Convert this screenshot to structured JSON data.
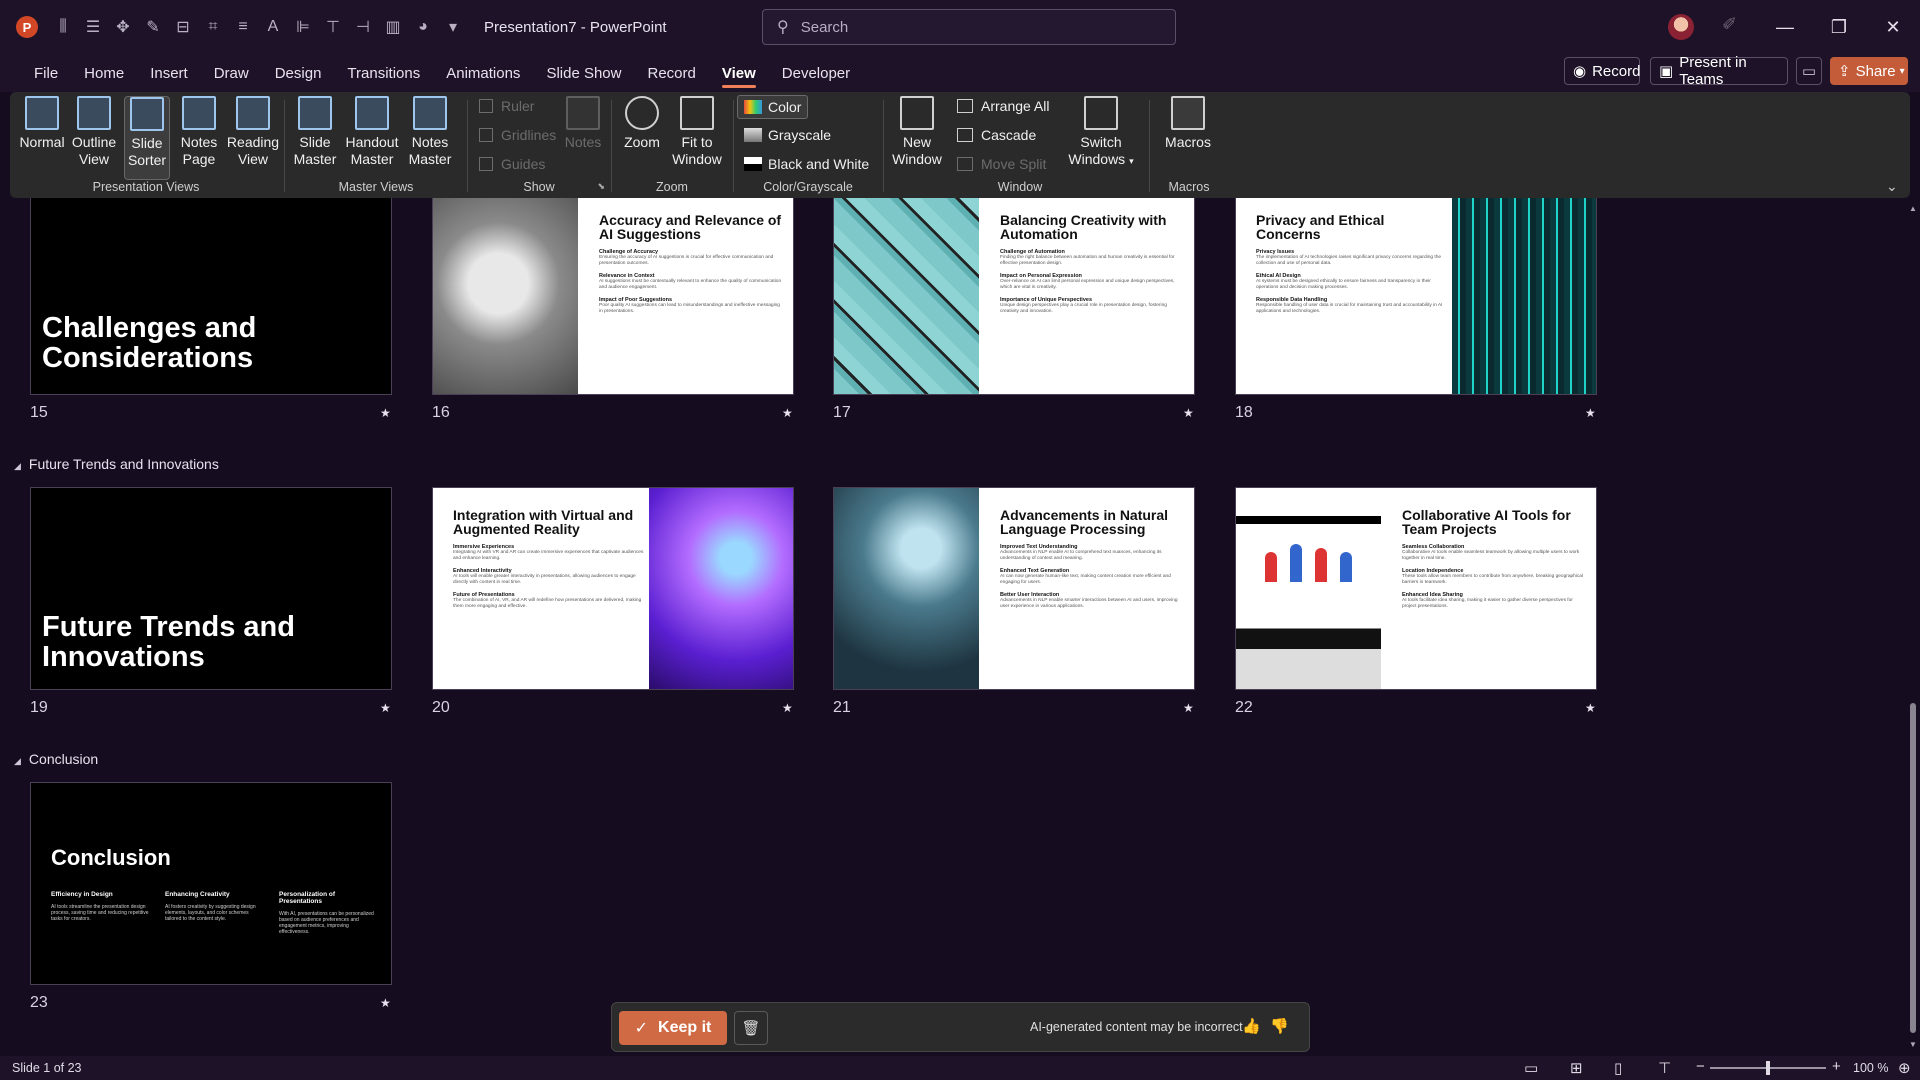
{
  "titlebar": {
    "app_title": "Presentation7 - PowerPoint",
    "search_placeholder": "Search"
  },
  "menu": [
    "File",
    "Home",
    "Insert",
    "Draw",
    "Design",
    "Transitions",
    "Animations",
    "Slide Show",
    "Record",
    "View",
    "Developer"
  ],
  "active_menu": "View",
  "top_buttons": {
    "record": "Record",
    "present_teams": "Present in Teams",
    "share": "Share"
  },
  "ribbon": {
    "presentation_views": {
      "label": "Presentation Views",
      "buttons": [
        "Normal",
        "Outline View",
        "Slide Sorter",
        "Notes Page",
        "Reading View"
      ],
      "selected": "Slide Sorter"
    },
    "master_views": {
      "label": "Master Views",
      "buttons": [
        "Slide Master",
        "Handout Master",
        "Notes Master"
      ]
    },
    "show": {
      "label": "Show",
      "checks": [
        "Ruler",
        "Gridlines",
        "Guides"
      ],
      "notes": "Notes"
    },
    "zoom": {
      "label": "Zoom",
      "buttons": [
        "Zoom",
        "Fit to Window"
      ]
    },
    "color": {
      "label": "Color/Grayscale",
      "items": [
        "Color",
        "Grayscale",
        "Black and White"
      ]
    },
    "window": {
      "label": "Window",
      "new_window": "New Window",
      "items": [
        "Arrange All",
        "Cascade",
        "Move Split"
      ],
      "switch": "Switch Windows"
    },
    "macros": {
      "label": "Macros",
      "button": "Macros"
    }
  },
  "sections": {
    "future": "Future Trends and Innovations",
    "conclusion": "Conclusion"
  },
  "slides": [
    {
      "num": "15",
      "title": "Challenges and Considerations"
    },
    {
      "num": "16",
      "title": "Accuracy and Relevance of AI Suggestions",
      "items": [
        {
          "h": "Challenge of Accuracy",
          "t": "Ensuring the accuracy of AI suggestions is crucial for effective communication and presentation outcomes."
        },
        {
          "h": "Relevance in Context",
          "t": "AI suggestions must be contextually relevant to enhance the quality of communication and audience engagement."
        },
        {
          "h": "Impact of Poor Suggestions",
          "t": "Poor quality AI suggestions can lead to misunderstandings and ineffective messaging in presentations."
        }
      ]
    },
    {
      "num": "17",
      "title": "Balancing Creativity with Automation",
      "items": [
        {
          "h": "Challenge of Automation",
          "t": "Finding the right balance between automation and human creativity is essential for effective presentation design."
        },
        {
          "h": "Impact on Personal Expression",
          "t": "Over-reliance on AI can limit personal expression and unique design perspectives, which are vital in creativity."
        },
        {
          "h": "Importance of Unique Perspectives",
          "t": "Unique design perspectives play a crucial role in presentation design, fostering creativity and innovation."
        }
      ]
    },
    {
      "num": "18",
      "title": "Privacy and Ethical Concerns",
      "items": [
        {
          "h": "Privacy Issues",
          "t": "The implementation of AI technologies raises significant privacy concerns regarding the collection and use of personal data."
        },
        {
          "h": "Ethical AI Design",
          "t": "AI systems must be designed ethically to ensure fairness and transparency in their operations and decision making processes."
        },
        {
          "h": "Responsible Data Handling",
          "t": "Responsible handling of user data is crucial for maintaining trust and accountability in AI applications and technologies."
        }
      ]
    },
    {
      "num": "19",
      "title": "Future Trends and Innovations"
    },
    {
      "num": "20",
      "title": "Integration with Virtual and Augmented Reality",
      "items": [
        {
          "h": "Immersive Experiences",
          "t": "Integrating AI with VR and AR can create immersive experiences that captivate audiences and enhance learning."
        },
        {
          "h": "Enhanced Interactivity",
          "t": "AI tools will enable greater interactivity in presentations, allowing audiences to engage directly with content in real time."
        },
        {
          "h": "Future of Presentations",
          "t": "The combination of AI, VR, and AR will redefine how presentations are delivered, making them more engaging and effective."
        }
      ]
    },
    {
      "num": "21",
      "title": "Advancements in Natural Language Processing",
      "items": [
        {
          "h": "Improved Text Understanding",
          "t": "Advancements in NLP enable AI to comprehend text nuances, enhancing its understanding of context and meaning."
        },
        {
          "h": "Enhanced Text Generation",
          "t": "AI can now generate human-like text, making content creation more efficient and engaging for users."
        },
        {
          "h": "Better User Interaction",
          "t": "Advancements in NLP enable smarter interactions between AI and users, improving user experience in various applications."
        }
      ]
    },
    {
      "num": "22",
      "title": "Collaborative AI Tools for Team Projects",
      "items": [
        {
          "h": "Seamless Collaboration",
          "t": "Collaborative AI tools enable seamless teamwork by allowing multiple users to work together in real time."
        },
        {
          "h": "Location Independence",
          "t": "These tools allow team members to contribute from anywhere, breaking geographical barriers in teamwork."
        },
        {
          "h": "Enhanced Idea Sharing",
          "t": "AI tools facilitate idea sharing, making it easier to gather diverse perspectives for project presentations."
        }
      ]
    },
    {
      "num": "23",
      "title": "Conclusion",
      "items": [
        {
          "h": "Efficiency in Design",
          "t": "AI tools streamline the presentation design process, saving time and reducing repetitive tasks for creators."
        },
        {
          "h": "Enhancing Creativity",
          "t": "AI fosters creativity by suggesting design elements, layouts, and color schemes tailored to the content style."
        },
        {
          "h": "Personalization of Presentations",
          "t": "With AI, presentations can be personalized based on audience preferences and engagement metrics, improving effectiveness."
        }
      ]
    }
  ],
  "ai_bar": {
    "keep": "Keep it",
    "note": "AI-generated content may be incorrect"
  },
  "status": {
    "slide_info": "Slide 1 of 23",
    "zoom": "100 %"
  }
}
